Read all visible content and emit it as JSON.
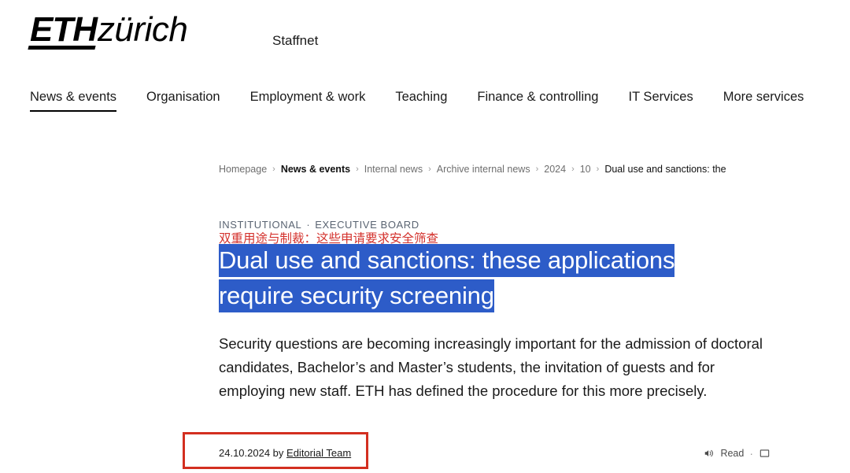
{
  "header": {
    "logo_eth": "ETH",
    "logo_zurich": "zürich",
    "portal_name": "Staffnet"
  },
  "nav": {
    "items": [
      {
        "label": "News & events",
        "active": true
      },
      {
        "label": "Organisation",
        "active": false
      },
      {
        "label": "Employment & work",
        "active": false
      },
      {
        "label": "Teaching",
        "active": false
      },
      {
        "label": "Finance & controlling",
        "active": false
      },
      {
        "label": "IT Services",
        "active": false
      },
      {
        "label": "More services",
        "active": false
      }
    ]
  },
  "breadcrumb": {
    "separator": "›",
    "items": [
      {
        "label": "Homepage",
        "style": "normal"
      },
      {
        "label": "News & events",
        "style": "strong"
      },
      {
        "label": "Internal news",
        "style": "normal"
      },
      {
        "label": "Archive internal news",
        "style": "normal"
      },
      {
        "label": "2024",
        "style": "normal"
      },
      {
        "label": "10",
        "style": "normal"
      },
      {
        "label": "Dual use and sanctions: the",
        "style": "current"
      }
    ]
  },
  "article": {
    "kicker_first": "INSTITUTIONAL",
    "kicker_dot": "·",
    "kicker_second": "EXECUTIVE BOARD",
    "title_translation": "双重用途与制裁：这些申请要求安全筛查",
    "headline_line_1": "Dual use and sanctions: these applications",
    "headline_line_2": "require security screening",
    "lead": "Security questions are becoming increasingly important for the admission of doctoral candidates, Bachelor’s and Master’s students, the invitation of guests and for employing new staff. ETH has defined the procedure for this more precisely.",
    "date": "24.10.2024 by",
    "author": "Editorial Team"
  },
  "meta_tools": {
    "read_label": "Read",
    "separator": "·"
  },
  "colors": {
    "selection_blue": "#2d5cc8",
    "translation_red": "#d4332e",
    "annotation_red": "#d32f20",
    "kicker_gray": "#5a6472"
  }
}
